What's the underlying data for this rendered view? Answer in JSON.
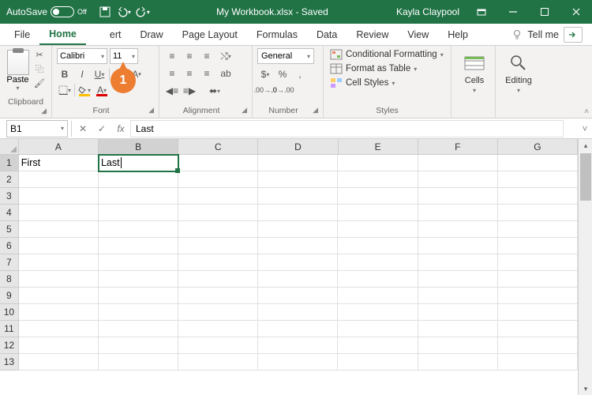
{
  "titlebar": {
    "autosave_label": "AutoSave",
    "autosave_state": "Off",
    "filename": "My Workbook.xlsx - Saved",
    "user": "Kayla Claypool"
  },
  "tabs": {
    "file": "File",
    "home": "Home",
    "insert": "ert",
    "draw": "Draw",
    "page_layout": "Page Layout",
    "formulas": "Formulas",
    "data": "Data",
    "review": "Review",
    "view": "View",
    "help": "Help",
    "tellme": "Tell me"
  },
  "ribbon": {
    "clipboard": {
      "paste": "Paste",
      "label": "Clipboard"
    },
    "font": {
      "name": "Calibri",
      "size": "11",
      "label": "Font"
    },
    "alignment": {
      "label": "Alignment"
    },
    "number": {
      "format": "General",
      "label": "Number"
    },
    "styles": {
      "conditional": "Conditional Formatting",
      "table": "Format as Table",
      "cell": "Cell Styles",
      "label": "Styles"
    },
    "cells": {
      "btn": "Cells"
    },
    "editing": {
      "btn": "Editing"
    }
  },
  "callout": "1",
  "formula_bar": {
    "cell_ref": "B1",
    "formula": "Last"
  },
  "grid": {
    "cols": [
      "A",
      "B",
      "C",
      "D",
      "E",
      "F",
      "G"
    ],
    "rows": [
      "1",
      "2",
      "3",
      "4",
      "5",
      "6",
      "7",
      "8",
      "9",
      "10",
      "11",
      "12",
      "13"
    ],
    "active_col": 1,
    "active_row": 0,
    "cells": {
      "A1": "First",
      "B1": "Last"
    }
  }
}
